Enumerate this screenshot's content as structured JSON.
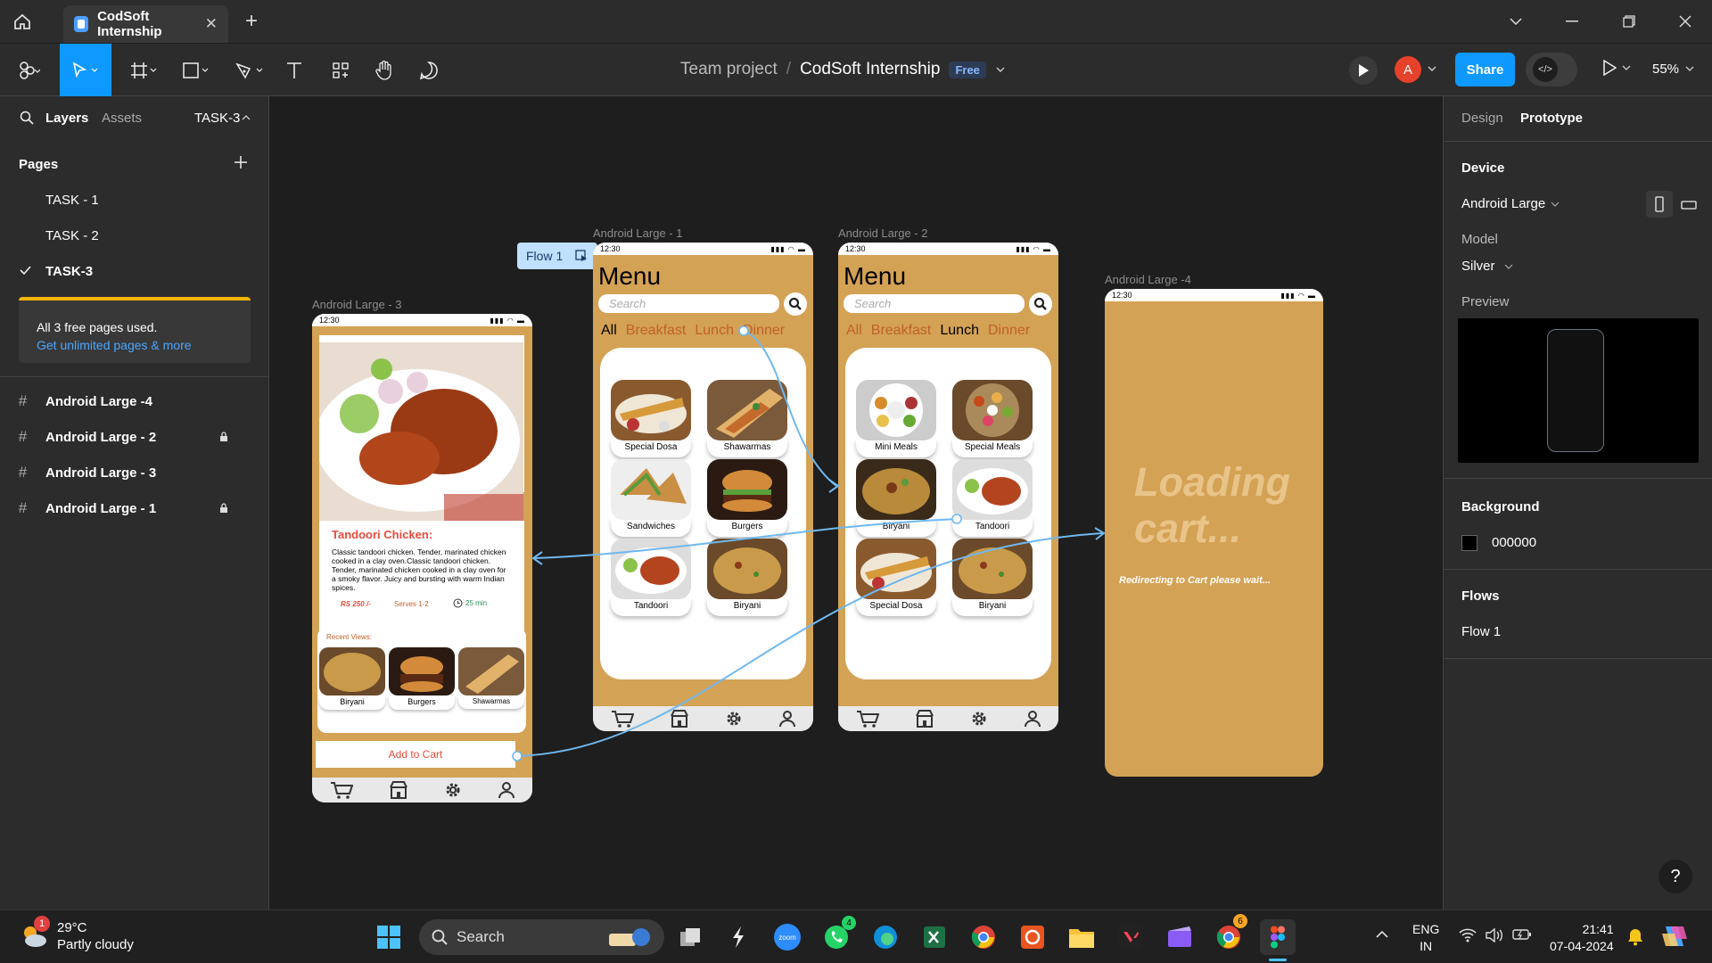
{
  "window": {
    "tab_title": "CodSoft Internship",
    "new_tab": "+"
  },
  "toolbar": {
    "team": "Team project",
    "separator": "/",
    "file": "CodSoft Internship",
    "plan_badge": "Free",
    "avatar_letter": "A",
    "share_label": "Share",
    "dev_mode_icon": "</>",
    "zoom": "55%"
  },
  "left_panel": {
    "tab_layers": "Layers",
    "tab_assets": "Assets",
    "current_page": "TASK-3",
    "pages_header": "Pages",
    "pages": [
      "TASK - 1",
      "TASK - 2",
      "TASK-3"
    ],
    "plan_notice": "All 3 free pages used.",
    "plan_link": "Get unlimited pages & more",
    "layers": [
      {
        "name": "Android Large -4",
        "locked": false
      },
      {
        "name": "Android Large - 2",
        "locked": true
      },
      {
        "name": "Android Large - 3",
        "locked": false
      },
      {
        "name": "Android Large - 1",
        "locked": true
      }
    ]
  },
  "right_panel": {
    "tab_design": "Design",
    "tab_prototype": "Prototype",
    "device_header": "Device",
    "device_value": "Android Large",
    "model_label": "Model",
    "model_value": "Silver",
    "preview_label": "Preview",
    "background_header": "Background",
    "background_hex": "000000",
    "flows_header": "Flows",
    "flow_item": "Flow 1",
    "help": "?"
  },
  "canvas": {
    "flow_badge": "Flow 1",
    "frames": {
      "f1": {
        "label": "Android Large - 1",
        "time": "12:30",
        "title": "Menu",
        "search_placeholder": "Search",
        "categories": [
          "All",
          "Breakfast",
          "Lunch",
          "Dinner"
        ],
        "items": [
          "Special Dosa",
          "Shawarmas",
          "Sandwiches",
          "Burgers",
          "Tandoori",
          "Biryani"
        ]
      },
      "f2": {
        "label": "Android Large - 2",
        "time": "12:30",
        "title": "Menu",
        "search_placeholder": "Search",
        "categories": [
          "All",
          "Breakfast",
          "Lunch",
          "Dinner"
        ],
        "items": [
          "Mini Meals",
          "Special Meals",
          "Biryani",
          "Tandoori",
          "Special Dosa",
          "Biryani"
        ]
      },
      "f3": {
        "label": "Android Large - 3",
        "time": "12:30",
        "dish_title": "Tandoori Chicken:",
        "dish_desc": "Classic tandoori chicken. Tender, marinated chicken cooked in a clay oven.Classic tandoori chicken. Tender, marinated chicken cooked in a clay oven for a smoky flavor.  Juicy and bursting with warm Indian spices.",
        "price": "RS 250 /-",
        "serves": "Serves 1-2",
        "time_needed": "25 min",
        "recent_label": "Recent Views:",
        "recent_items": [
          "Biryani",
          "Burgers",
          "Shawarmas"
        ],
        "add_to_cart": "Add to Cart"
      },
      "f4": {
        "label": "Android Large -4",
        "time": "12:30",
        "loading_line1": "Loading",
        "loading_line2": "cart...",
        "redirect": "Redirecting to Cart please wait..."
      }
    }
  },
  "taskbar": {
    "temperature": "29°C",
    "condition": "Partly cloudy",
    "weather_badge": "1",
    "search_label": "Search",
    "whatsapp_badge": "4",
    "chrome_badge": "6",
    "lang_line1": "ENG",
    "lang_line2": "IN",
    "time": "21:41",
    "date": "07-04-2024"
  },
  "colors": {
    "accent": "#0d99ff",
    "phone_bg": "#d4a255",
    "category": "#c0612a",
    "plan_bar": "#f5b400"
  }
}
